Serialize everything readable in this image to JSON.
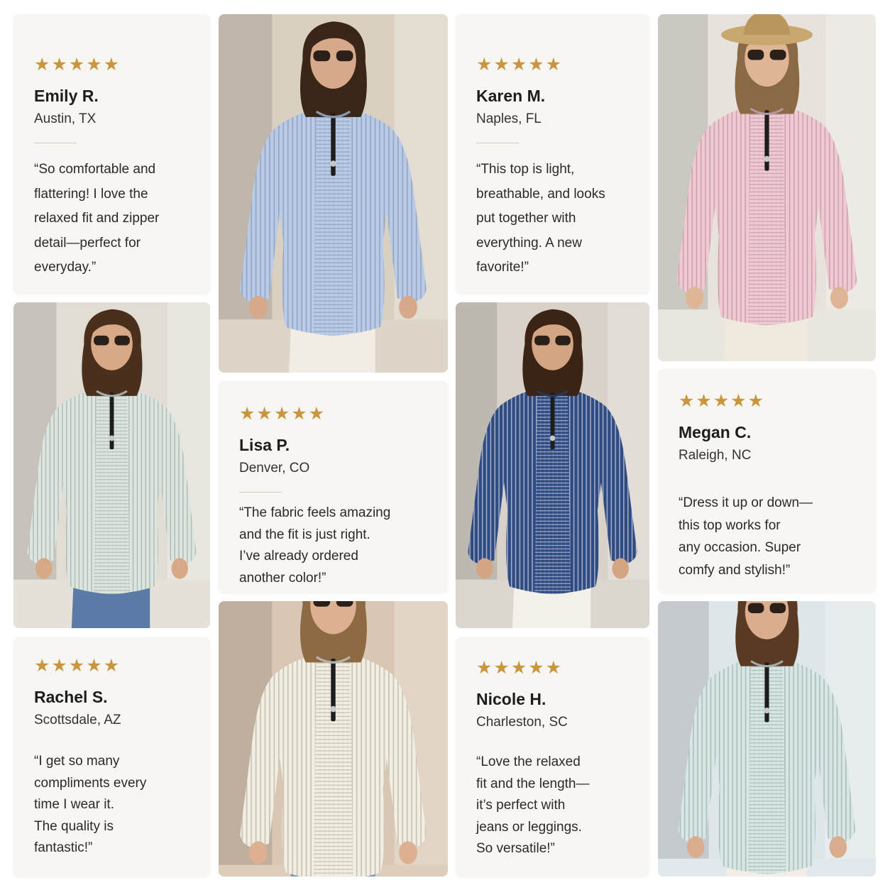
{
  "colors": {
    "card_bg": "#f8f6f2",
    "star": "#c9963f",
    "blue_top": "#b8cbe8",
    "pink_top": "#f2c9d3",
    "mint_top": "#dbe6de",
    "navy_top": "#2f4b82",
    "cream_top": "#f3eee2",
    "aqua_top": "#d6e7e5"
  },
  "reviews": [
    {
      "stars": "★★★★★",
      "name": "Emily R.",
      "location": "Austin, TX",
      "quote_lines": [
        "“So comfortable and",
        "flattering! I love the",
        "relaxed fit and zipper",
        "detail—perfect for",
        "everyday.”"
      ]
    },
    {
      "stars": "★★★★★",
      "name": "Karen M.",
      "location": "Naples, FL",
      "quote_lines": [
        "“This top is light,",
        "breathable, and looks",
        "put together with",
        "everything. A new",
        "favorite!”"
      ]
    },
    {
      "stars": "★★★★★",
      "name": "Lisa P.",
      "location": "Denver, CO",
      "quote_lines": [
        "“The fabric feels amazing",
        "and the fit is just right.",
        "I’ve already ordered",
        "another color!”"
      ]
    },
    {
      "stars": "★★★★★",
      "name": "Megan C.",
      "location": "Raleigh, NC",
      "quote_lines": [
        "“Dress it up or down—",
        "this top works for",
        "any occasion. Super",
        "comfy and stylish!”"
      ]
    },
    {
      "stars": "★★★★★",
      "name": "Rachel S.",
      "location": "Scottsdale, AZ",
      "quote_lines": [
        "“I get so many",
        "compliments every",
        "time I wear it.",
        "The quality is",
        "fantastic!”"
      ]
    },
    {
      "stars": "★★★★★",
      "name": "Nicole H.",
      "location": "Charleston, SC",
      "quote_lines": [
        "“Love the relaxed",
        "fit and the length—",
        "it’s perfect with",
        "jeans or leggings.",
        "So versatile!”"
      ]
    }
  ]
}
